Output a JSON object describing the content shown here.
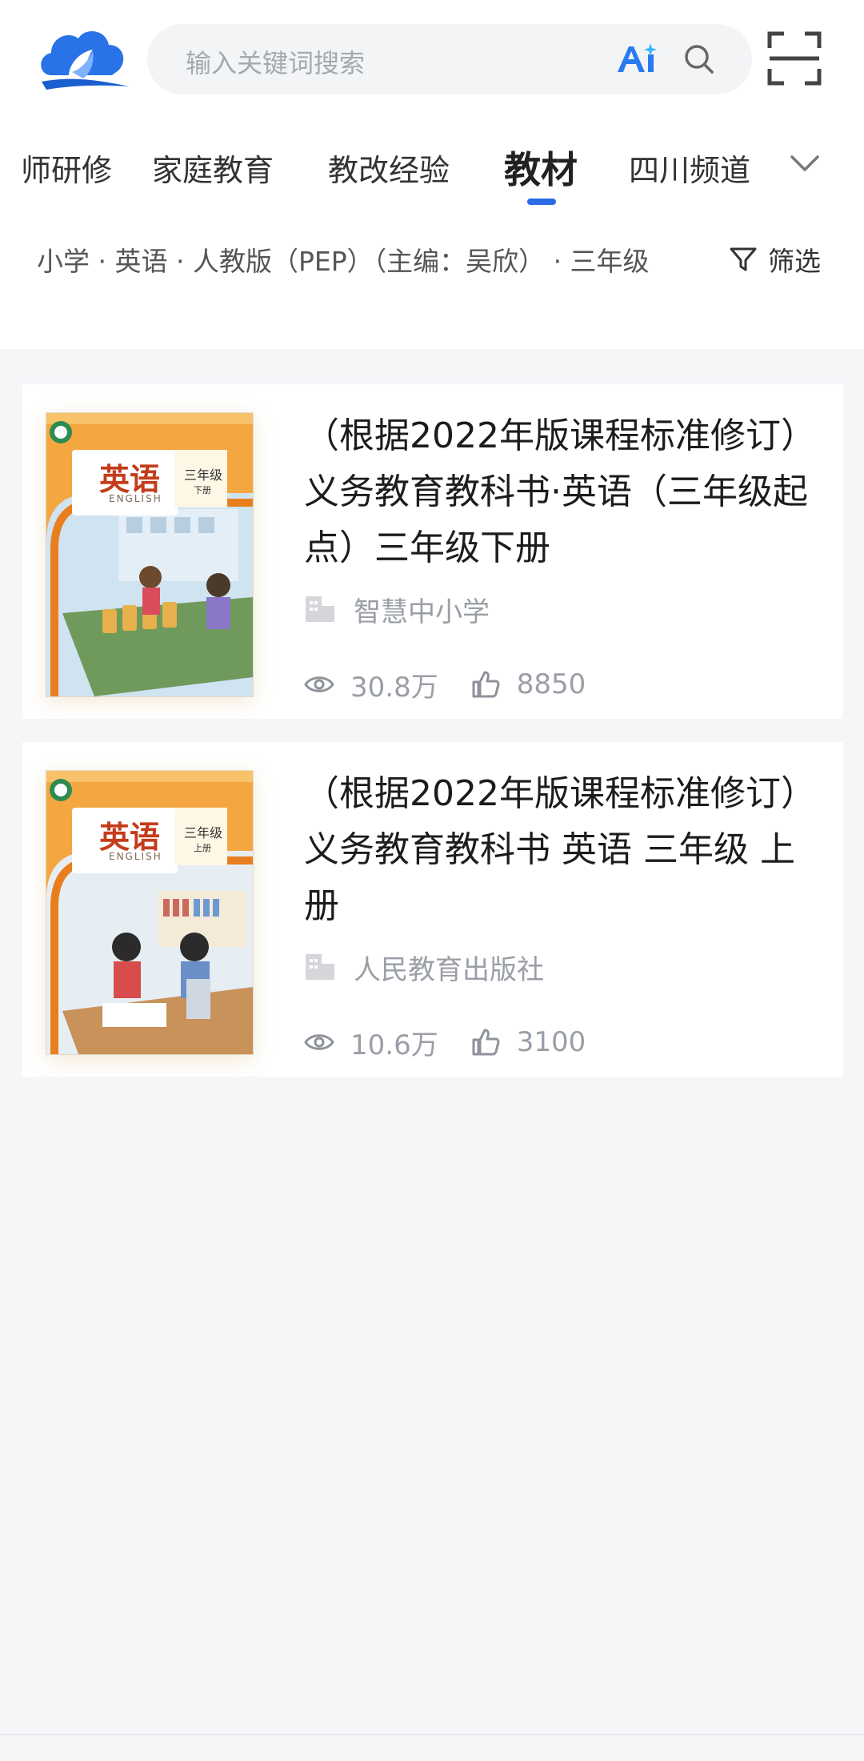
{
  "search": {
    "placeholder": "输入关键词搜索"
  },
  "icons": {
    "logo": "cloud-book-logo",
    "ai": "ai-icon",
    "search": "search-icon",
    "scan": "scan-icon",
    "more": "chevron-down-icon",
    "filter": "filter-icon",
    "publisher": "building-icon",
    "views": "eye-icon",
    "likes": "thumb-up-icon"
  },
  "colors": {
    "accent": "#2b6be6",
    "brand": "#1f6fe0"
  },
  "tabs": [
    {
      "label": "师研修"
    },
    {
      "label": "家庭教育"
    },
    {
      "label": "教改经验"
    },
    {
      "label": "教材",
      "active": true
    },
    {
      "label": "四川频道"
    }
  ],
  "breadcrumb": "小学 · 英语 · 人教版（PEP）（主编：吴欣） · 三年级",
  "filter": {
    "label": "筛选"
  },
  "books": [
    {
      "title": "（根据2022年版课程标准修订）义务教育教科书·英语（三年级起点）三年级下册",
      "publisher": "智慧中小学",
      "views": "30.8万",
      "likes": "8850",
      "cover": {
        "subject": "英语",
        "english": "ENGLISH",
        "grade": "三年级",
        "volume": "下册"
      }
    },
    {
      "title": "（根据2022年版课程标准修订）义务教育教科书 英语 三年级 上册",
      "publisher": "人民教育出版社",
      "views": "10.6万",
      "likes": "3100",
      "cover": {
        "subject": "英语",
        "english": "ENGLISH",
        "grade": "三年级",
        "volume": "上册"
      }
    }
  ]
}
